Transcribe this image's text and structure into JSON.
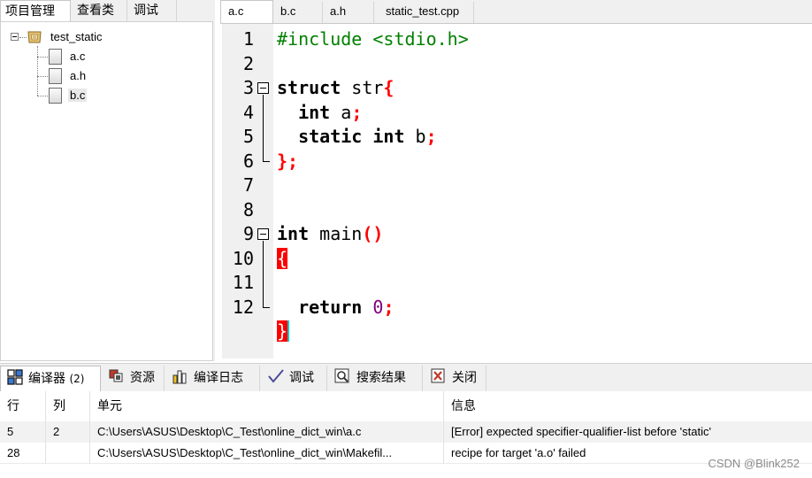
{
  "left_panel": {
    "tabs": [
      "项目管理",
      "查看类",
      "调试"
    ],
    "tree": {
      "project": "test_static",
      "files": [
        "a.c",
        "a.h",
        "b.c"
      ]
    }
  },
  "editor": {
    "tabs": [
      "a.c",
      "b.c",
      "a.h",
      "static_test.cpp"
    ],
    "line_numbers": [
      "1",
      "2",
      "3",
      "4",
      "5",
      "6",
      "7",
      "8",
      "9",
      "10",
      "11",
      "12"
    ],
    "code": {
      "l1": "#include <stdio.h>",
      "l3_kw": "struct",
      "l3_name": " str",
      "l3_brace": "{",
      "l4_kw": "int",
      "l4_rest": " a",
      "l4_semi": ";",
      "l5_kw1": "static",
      "l5_kw2": "int",
      "l5_rest": " b",
      "l5_semi": ";",
      "l6": "};",
      "l8_kw": "int",
      "l8_rest": " main",
      "l8_paren": "()",
      "l9": "{",
      "l11_kw": "return",
      "l11_num": "0",
      "l11_semi": ";",
      "l12": "}"
    }
  },
  "bottom_panel": {
    "tabs": [
      {
        "label": "编译器",
        "count": "(2)"
      },
      {
        "label": "资源"
      },
      {
        "label": "编译日志"
      },
      {
        "label": "调试"
      },
      {
        "label": "搜索结果"
      },
      {
        "label": "关闭"
      }
    ],
    "columns": [
      "行",
      "列",
      "单元",
      "信息"
    ],
    "rows": [
      {
        "line": "5",
        "col": "2",
        "unit": "C:\\Users\\ASUS\\Desktop\\C_Test\\online_dict_win\\a.c",
        "message": "[Error] expected specifier-qualifier-list before 'static'"
      },
      {
        "line": "28",
        "col": "",
        "unit": "C:\\Users\\ASUS\\Desktop\\C_Test\\online_dict_win\\Makefil...",
        "message": "recipe for target 'a.o' failed"
      }
    ]
  },
  "watermark": "CSDN @Blink252",
  "colors": {
    "preprocessor": "#008000",
    "brace": "#ff0000",
    "number": "#800080",
    "gutter": "#f0f0f0"
  }
}
